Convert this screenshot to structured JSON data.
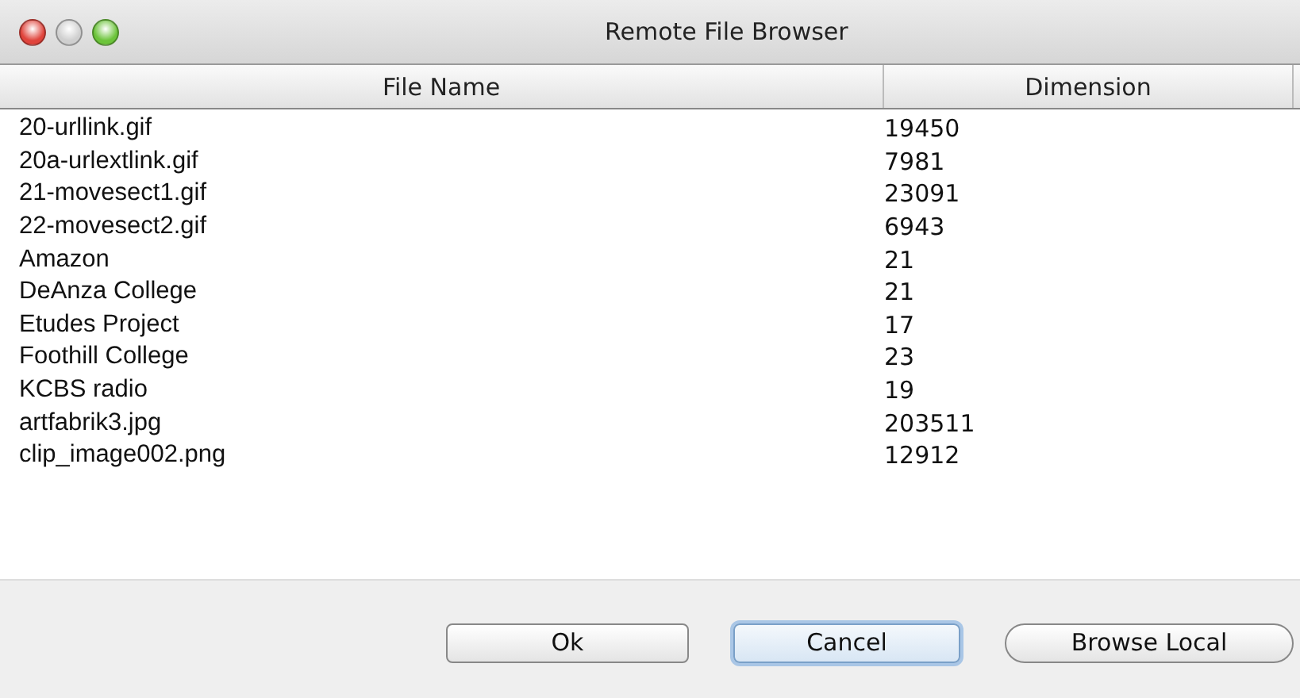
{
  "window": {
    "title": "Remote File Browser"
  },
  "table": {
    "columns": [
      "File Name",
      "Dimension"
    ],
    "rows": [
      [
        "20-urllink.gif",
        "19450"
      ],
      [
        "20a-urlextlink.gif",
        "7981"
      ],
      [
        "21-movesect1.gif",
        "23091"
      ],
      [
        "22-movesect2.gif",
        "6943"
      ],
      [
        "Amazon",
        "21"
      ],
      [
        "DeAnza College",
        "21"
      ],
      [
        "Etudes Project",
        "17"
      ],
      [
        "Foothill College",
        "23"
      ],
      [
        "KCBS radio",
        "19"
      ],
      [
        "artfabrik3.jpg",
        "203511"
      ],
      [
        "clip_image002.png",
        "12912"
      ]
    ]
  },
  "buttons": [
    {
      "label": "Ok",
      "kind": "square",
      "focused": false
    },
    {
      "label": "Cancel",
      "kind": "square",
      "focused": true
    },
    {
      "label": "Browse Local",
      "kind": "round",
      "focused": false
    }
  ]
}
